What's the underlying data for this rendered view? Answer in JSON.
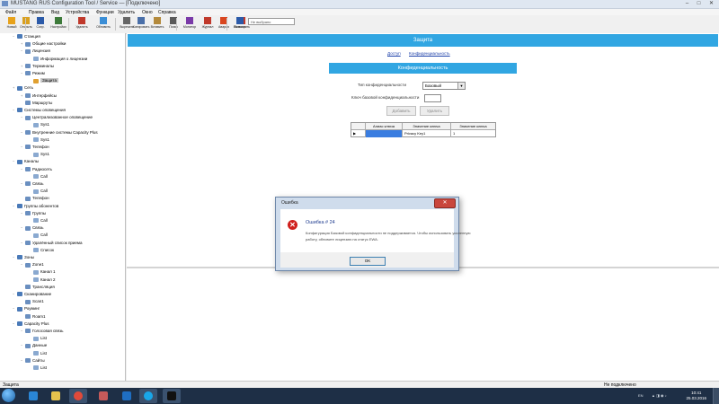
{
  "window": {
    "title": "MUSTANG RUS Configuration Tool / Service — [Подключено]",
    "controls": [
      "–",
      "□",
      "✕"
    ]
  },
  "menu": [
    "Файл",
    "Правка",
    "Вид",
    "Устройства",
    "Функции",
    "Удалить",
    "Окно",
    "Справка"
  ],
  "toolbar": {
    "buttons": [
      {
        "label": "Новый",
        "icon": "new-file-icon",
        "color": "#e8a21a"
      },
      {
        "label": "Открыть",
        "icon": "open-folder-icon",
        "color": "#d9a020"
      },
      {
        "label": "Сохр.",
        "icon": "save-icon",
        "color": "#2b5aa8"
      },
      {
        "label": "Настройки",
        "icon": "settings-icon",
        "color": "#3d7a3a"
      },
      {
        "label": "Удалить",
        "icon": "delete-icon",
        "color": "#c0392b"
      },
      {
        "label": "Обновить",
        "icon": "refresh-icon",
        "color": "#3b8ed6"
      },
      {
        "label": "Вырезать",
        "icon": "cut-icon",
        "color": "#666666"
      },
      {
        "label": "Копировать",
        "icon": "copy-icon",
        "color": "#4a6fa8"
      },
      {
        "label": "Вставить",
        "icon": "paste-icon",
        "color": "#b48a3c"
      },
      {
        "label": "Поиск",
        "icon": "search-icon",
        "color": "#5a5a5a"
      },
      {
        "label": "Монитор",
        "icon": "monitor-icon",
        "color": "#7a3aa8"
      },
      {
        "label": "Журнал",
        "icon": "log-icon",
        "color": "#c0392b"
      },
      {
        "label": "Авария",
        "icon": "alarm-icon",
        "color": "#d9461f"
      },
      {
        "label": "Выполнить",
        "icon": "run-icon",
        "color": "#c0392b"
      },
      {
        "label": "Помощь",
        "icon": "help-icon",
        "color": "#2b5aa8"
      }
    ],
    "combo_value": "Не выбрано"
  },
  "tree": [
    {
      "label": "Станция",
      "level": 0,
      "expander": "−",
      "color": "#4a7ab8"
    },
    {
      "label": "Общие настройки",
      "level": 1,
      "expander": "+",
      "color": "#6a8fc0"
    },
    {
      "label": "Лицензия",
      "level": 1,
      "expander": "−",
      "color": "#6a8fc0"
    },
    {
      "label": "Информация о лицензии",
      "level": 2,
      "expander": "",
      "color": "#8aa9d0"
    },
    {
      "label": "Терминалы",
      "level": 1,
      "expander": "+",
      "color": "#6a8fc0"
    },
    {
      "label": "Режим",
      "level": 1,
      "expander": "−",
      "color": "#6a8fc0"
    },
    {
      "label": "Защита",
      "level": 2,
      "expander": "",
      "color": "#e0a030",
      "selected": true
    },
    {
      "label": "Сеть",
      "level": 0,
      "expander": "+",
      "color": "#4a7ab8"
    },
    {
      "label": "Интерфейсы",
      "level": 1,
      "expander": "+",
      "color": "#6a8fc0"
    },
    {
      "label": "Маршруты",
      "level": 1,
      "expander": "",
      "color": "#6a8fc0"
    },
    {
      "label": "Системы оповещения",
      "level": 0,
      "expander": "−",
      "color": "#4a7ab8"
    },
    {
      "label": "Централизованное оповещение",
      "level": 1,
      "expander": "−",
      "color": "#6a8fc0"
    },
    {
      "label": "Sys1",
      "level": 2,
      "expander": "",
      "color": "#8aa9d0"
    },
    {
      "label": "Внутренние системы Capacity Plus",
      "level": 1,
      "expander": "−",
      "color": "#6a8fc0"
    },
    {
      "label": "Sys1",
      "level": 2,
      "expander": "",
      "color": "#8aa9d0"
    },
    {
      "label": "Телефон",
      "level": 1,
      "expander": "−",
      "color": "#6a8fc0"
    },
    {
      "label": "Sys1",
      "level": 2,
      "expander": "",
      "color": "#8aa9d0"
    },
    {
      "label": "Каналы",
      "level": 0,
      "expander": "−",
      "color": "#4a7ab8"
    },
    {
      "label": "Радиосеть",
      "level": 1,
      "expander": "−",
      "color": "#6a8fc0"
    },
    {
      "label": "Call",
      "level": 2,
      "expander": "",
      "color": "#8aa9d0"
    },
    {
      "label": "Связь",
      "level": 1,
      "expander": "−",
      "color": "#6a8fc0"
    },
    {
      "label": "Call",
      "level": 2,
      "expander": "",
      "color": "#8aa9d0"
    },
    {
      "label": "Телефон",
      "level": 1,
      "expander": "",
      "color": "#6a8fc0"
    },
    {
      "label": "Группы абонентов",
      "level": 0,
      "expander": "−",
      "color": "#4a7ab8"
    },
    {
      "label": "Группы",
      "level": 1,
      "expander": "−",
      "color": "#6a8fc0"
    },
    {
      "label": "Call",
      "level": 2,
      "expander": "",
      "color": "#8aa9d0"
    },
    {
      "label": "Связь",
      "level": 1,
      "expander": "−",
      "color": "#6a8fc0"
    },
    {
      "label": "Call",
      "level": 2,
      "expander": "",
      "color": "#8aa9d0"
    },
    {
      "label": "Удалённый список приема",
      "level": 1,
      "expander": "−",
      "color": "#6a8fc0"
    },
    {
      "label": "Список",
      "level": 2,
      "expander": "",
      "color": "#8aa9d0"
    },
    {
      "label": "Зоны",
      "level": 0,
      "expander": "−",
      "color": "#4a7ab8"
    },
    {
      "label": "Zone1",
      "level": 1,
      "expander": "−",
      "color": "#6a8fc0"
    },
    {
      "label": "Канал 1",
      "level": 2,
      "expander": "",
      "color": "#8aa9d0"
    },
    {
      "label": "Канал 2",
      "level": 2,
      "expander": "",
      "color": "#8aa9d0"
    },
    {
      "label": "Трансляция",
      "level": 1,
      "expander": "",
      "color": "#6a8fc0"
    },
    {
      "label": "Сканирование",
      "level": 0,
      "expander": "−",
      "color": "#4a7ab8"
    },
    {
      "label": "Scan1",
      "level": 1,
      "expander": "",
      "color": "#6a8fc0"
    },
    {
      "label": "Роуминг",
      "level": 0,
      "expander": "−",
      "color": "#4a7ab8"
    },
    {
      "label": "Roam1",
      "level": 1,
      "expander": "",
      "color": "#6a8fc0"
    },
    {
      "label": "Capacity Plus",
      "level": 0,
      "expander": "−",
      "color": "#4a7ab8"
    },
    {
      "label": "Голосовая связь",
      "level": 1,
      "expander": "−",
      "color": "#6a8fc0"
    },
    {
      "label": "List",
      "level": 2,
      "expander": "",
      "color": "#8aa9d0"
    },
    {
      "label": "Данные",
      "level": 1,
      "expander": "−",
      "color": "#6a8fc0"
    },
    {
      "label": "List",
      "level": 2,
      "expander": "",
      "color": "#8aa9d0"
    },
    {
      "label": "Сайты",
      "level": 1,
      "expander": "−",
      "color": "#6a8fc0"
    },
    {
      "label": "List",
      "level": 2,
      "expander": "",
      "color": "#8aa9d0"
    }
  ],
  "main": {
    "banner": "Защита",
    "links": [
      "Доступ",
      "Конфиденциальность"
    ],
    "section_header": "Конфиденциальность",
    "privacy_type_label": "Тип конфиденциальности",
    "privacy_type_value": "Базовый",
    "key_label": "Ключ базовой конфиденциальности",
    "key_value": "",
    "add_button": "Добавить",
    "delete_button": "Удалить",
    "grid": {
      "columns": [
        "",
        "Алиас ключа",
        "Значение ключа",
        "Значение ключа"
      ],
      "row": [
        "▶",
        "",
        "Privacy Key1",
        "1"
      ]
    }
  },
  "dialog": {
    "title": "Ошибка",
    "heading": "Ошибка # 24",
    "message_lines": [
      "Конфигурация Базовой конфиденциальности не поддерживается. Чтобы использовать усиленную",
      "работу, обновите лицензию на статус EWA."
    ],
    "ok_button": "OK",
    "close_glyph": "✕"
  },
  "status": {
    "left": "Защита",
    "right": "Не подключено"
  },
  "taskbar": {
    "tray_lang": "EN",
    "time": "10:41",
    "date": "25.03.2016"
  }
}
